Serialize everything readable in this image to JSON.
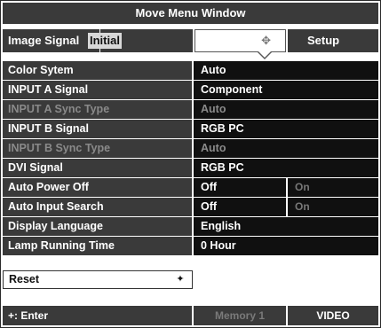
{
  "window": {
    "title": "Move Menu Window"
  },
  "tabs": {
    "image_signal": "Image Signal",
    "initial": "Initial",
    "setup": "Setup"
  },
  "settings": [
    {
      "label": "Color Sytem",
      "value": "Auto"
    },
    {
      "label": "INPUT A Signal",
      "value": "Component"
    },
    {
      "label": "INPUT A Sync Type",
      "value": "Auto",
      "disabled": true
    },
    {
      "label": "INPUT B Signal",
      "value": "RGB PC"
    },
    {
      "label": "INPUT B Sync Type",
      "value": "Auto",
      "disabled": true
    },
    {
      "label": "DVI Signal",
      "value": "RGB PC"
    },
    {
      "label": "Auto Power Off",
      "value": "Off",
      "option2": "On"
    },
    {
      "label": "Auto Input Search",
      "value": "Off",
      "option2": "On"
    },
    {
      "label": "Display Language",
      "value": "English"
    },
    {
      "label": "Lamp Running Time",
      "value": "0 Hour"
    }
  ],
  "reset": {
    "label": "Reset"
  },
  "footer": {
    "enter": "+: Enter",
    "memory": "Memory 1",
    "source": "VIDEO"
  },
  "icons": {
    "move": "move-icon",
    "cursor": "cursor-icon"
  }
}
